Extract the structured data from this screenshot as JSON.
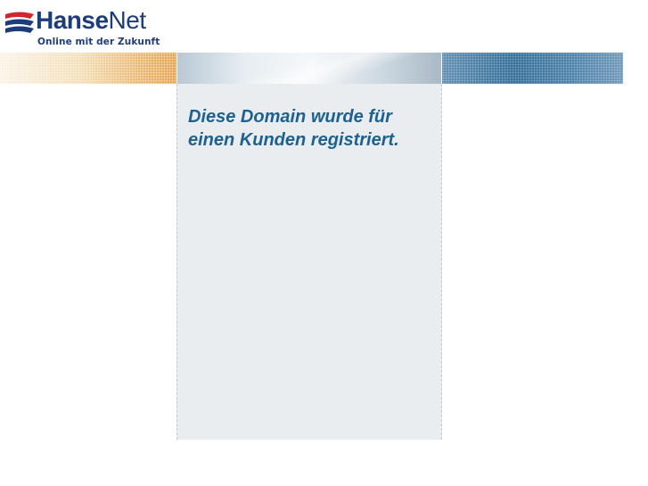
{
  "logo": {
    "brand_bold": "Hanse",
    "brand_regular": "Net",
    "tagline": "Online mit der Zukunft",
    "color": "#1d3c7a",
    "accent_color": "#d1262f"
  },
  "banner": {
    "left_color": "#eab46a",
    "middle_color": "#e6edf2",
    "right_color": "#2f6b96"
  },
  "content": {
    "message": "Diese Domain wurde für einen Kunden registriert.",
    "message_color": "#1c6190",
    "panel_color": "#e9edf0"
  }
}
